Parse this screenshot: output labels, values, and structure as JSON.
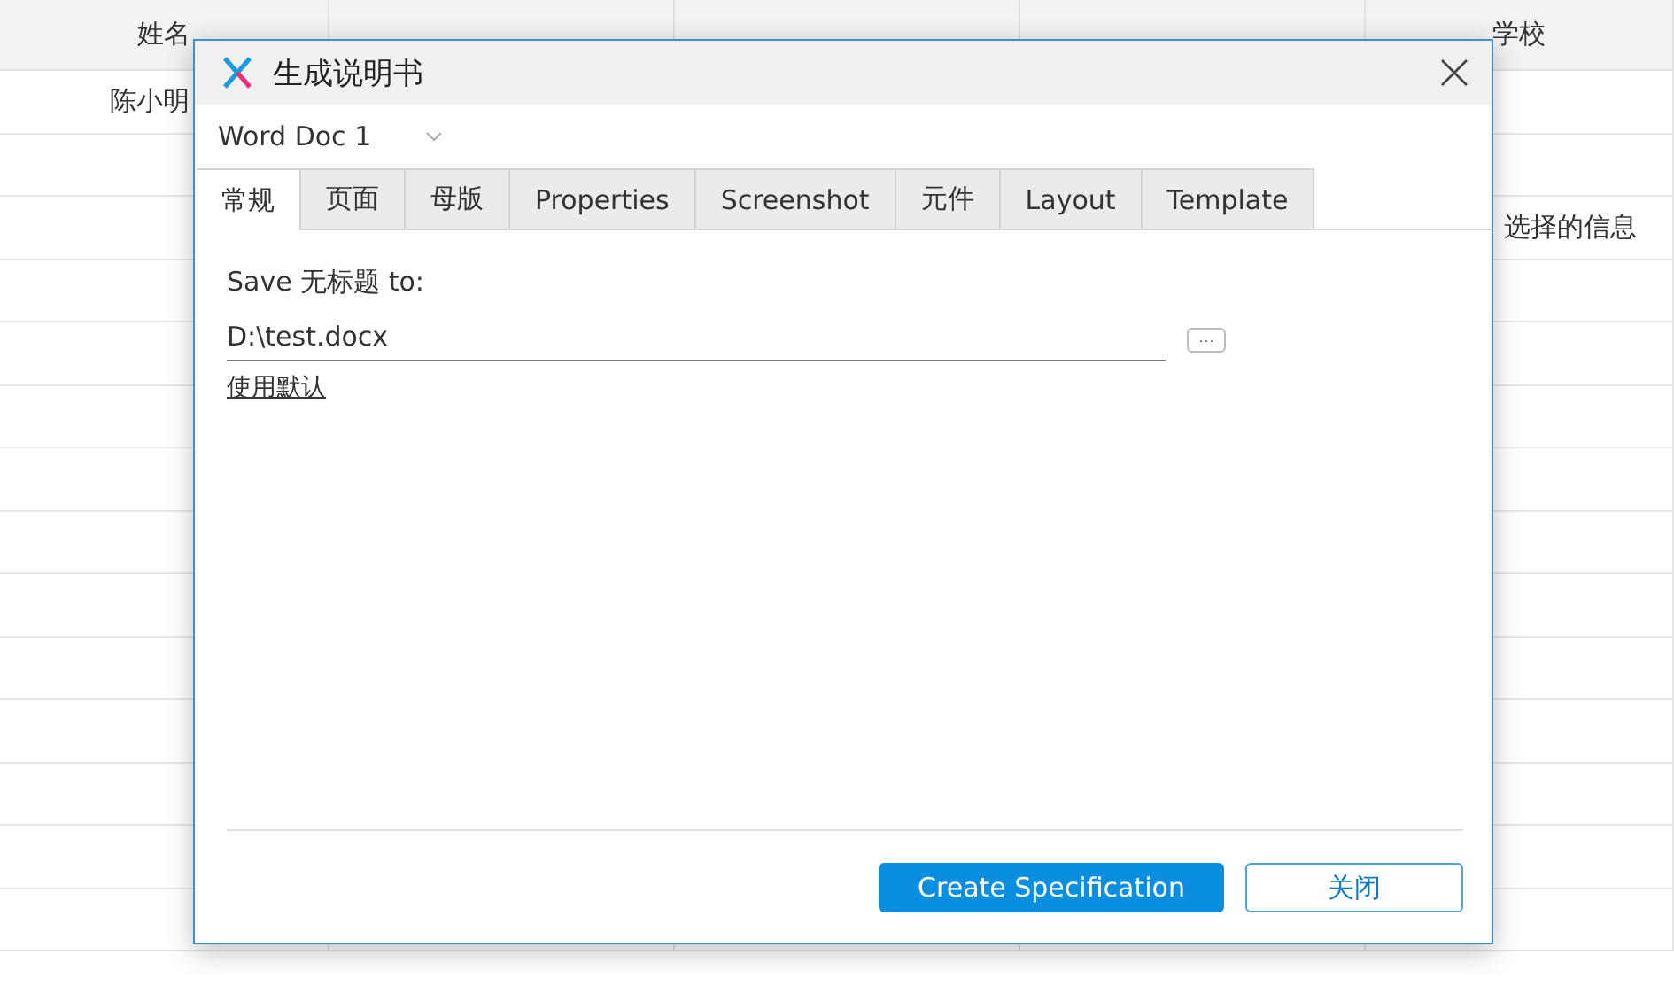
{
  "table": {
    "columns": [
      {
        "label": "姓名"
      },
      {},
      {},
      {},
      {
        "label": "学校"
      }
    ],
    "rows": [
      {
        "name": "陈小明"
      },
      {},
      {
        "school": "选择的信息"
      }
    ]
  },
  "dialog": {
    "title": "生成说明书",
    "format": {
      "value": "Word Doc 1"
    },
    "tabs": [
      {
        "label": "常规",
        "selected": true
      },
      {
        "label": "页面",
        "selected": false
      },
      {
        "label": "母版",
        "selected": false
      },
      {
        "label": "Properties",
        "selected": false
      },
      {
        "label": "Screenshot",
        "selected": false
      },
      {
        "label": "元件",
        "selected": false
      },
      {
        "label": "Layout",
        "selected": false
      },
      {
        "label": "Template",
        "selected": false
      }
    ],
    "save_label": "Save 无标题 to:",
    "path": {
      "value": "D:\\test.docx"
    },
    "browse_button": "···",
    "use_default_link": "使用默认",
    "buttons": [
      {
        "label": "Create Specification",
        "kind": "primary"
      },
      {
        "label": "关闭",
        "kind": "secondary"
      }
    ]
  }
}
